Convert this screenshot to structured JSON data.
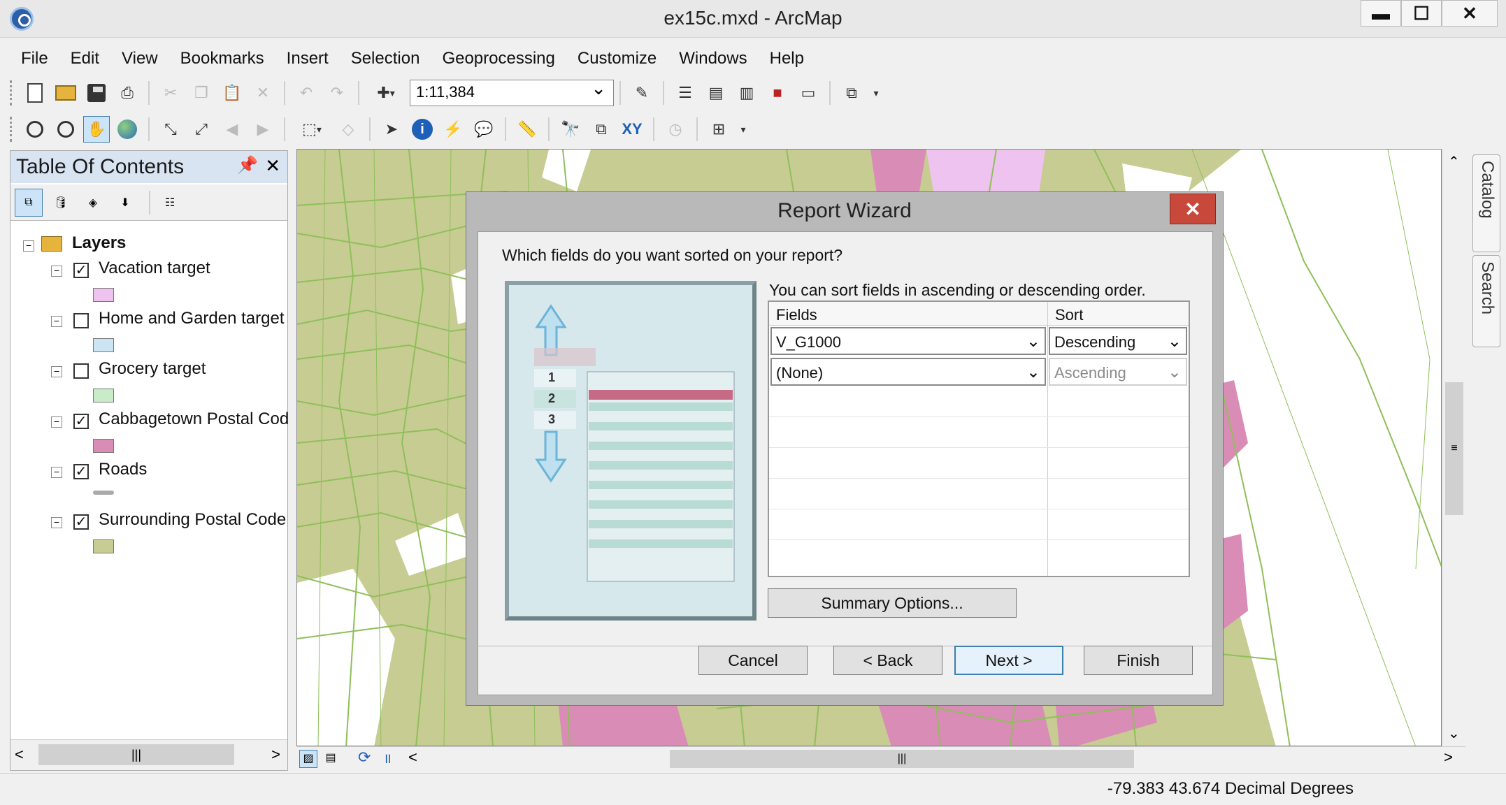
{
  "window": {
    "title": "ex15c.mxd - ArcMap",
    "minimize": "▬",
    "maximize": "☐",
    "close": "✕"
  },
  "menu": [
    "File",
    "Edit",
    "View",
    "Bookmarks",
    "Insert",
    "Selection",
    "Geoprocessing",
    "Customize",
    "Windows",
    "Help"
  ],
  "toolbar": {
    "scale": "1:11,384"
  },
  "toc": {
    "title": "Table Of Contents",
    "root": "Layers",
    "layers": [
      {
        "name": "Vacation target",
        "checked": true,
        "color": "#efc3f0"
      },
      {
        "name": "Home and Garden target",
        "checked": false,
        "color": "#cde4f4"
      },
      {
        "name": "Grocery target",
        "checked": false,
        "color": "#c8ecc8"
      },
      {
        "name": "Cabbagetown Postal Cod",
        "checked": true,
        "color": "#d98db6"
      },
      {
        "name": "Roads",
        "checked": true,
        "color": "#aaaaaa"
      },
      {
        "name": "Surrounding Postal Code",
        "checked": true,
        "color": "#c7cc92"
      }
    ]
  },
  "side_tabs": [
    "Catalog",
    "Search"
  ],
  "status": {
    "coords": "-79.383  43.674 Decimal Degrees"
  },
  "dialog": {
    "title": "Report Wizard",
    "close": "✕",
    "question": "Which fields do you want sorted on your report?",
    "hint": "You can sort fields in ascending or descending order.",
    "columns": [
      "Fields",
      "Sort"
    ],
    "rows": [
      {
        "field": "V_G1000",
        "sort": "Descending"
      },
      {
        "field": "(None)",
        "sort": "Ascending"
      }
    ],
    "illustration": {
      "steps": [
        "1",
        "2",
        "3"
      ]
    },
    "summary_button": "Summary Options...",
    "buttons": {
      "cancel": "Cancel",
      "back": "< Back",
      "next": "Next >",
      "finish": "Finish"
    }
  },
  "colors": {
    "map_bg": "#c7cc92",
    "road": "#8fbf5a",
    "pink": "#d98db6",
    "lilac": "#efc3f0"
  }
}
